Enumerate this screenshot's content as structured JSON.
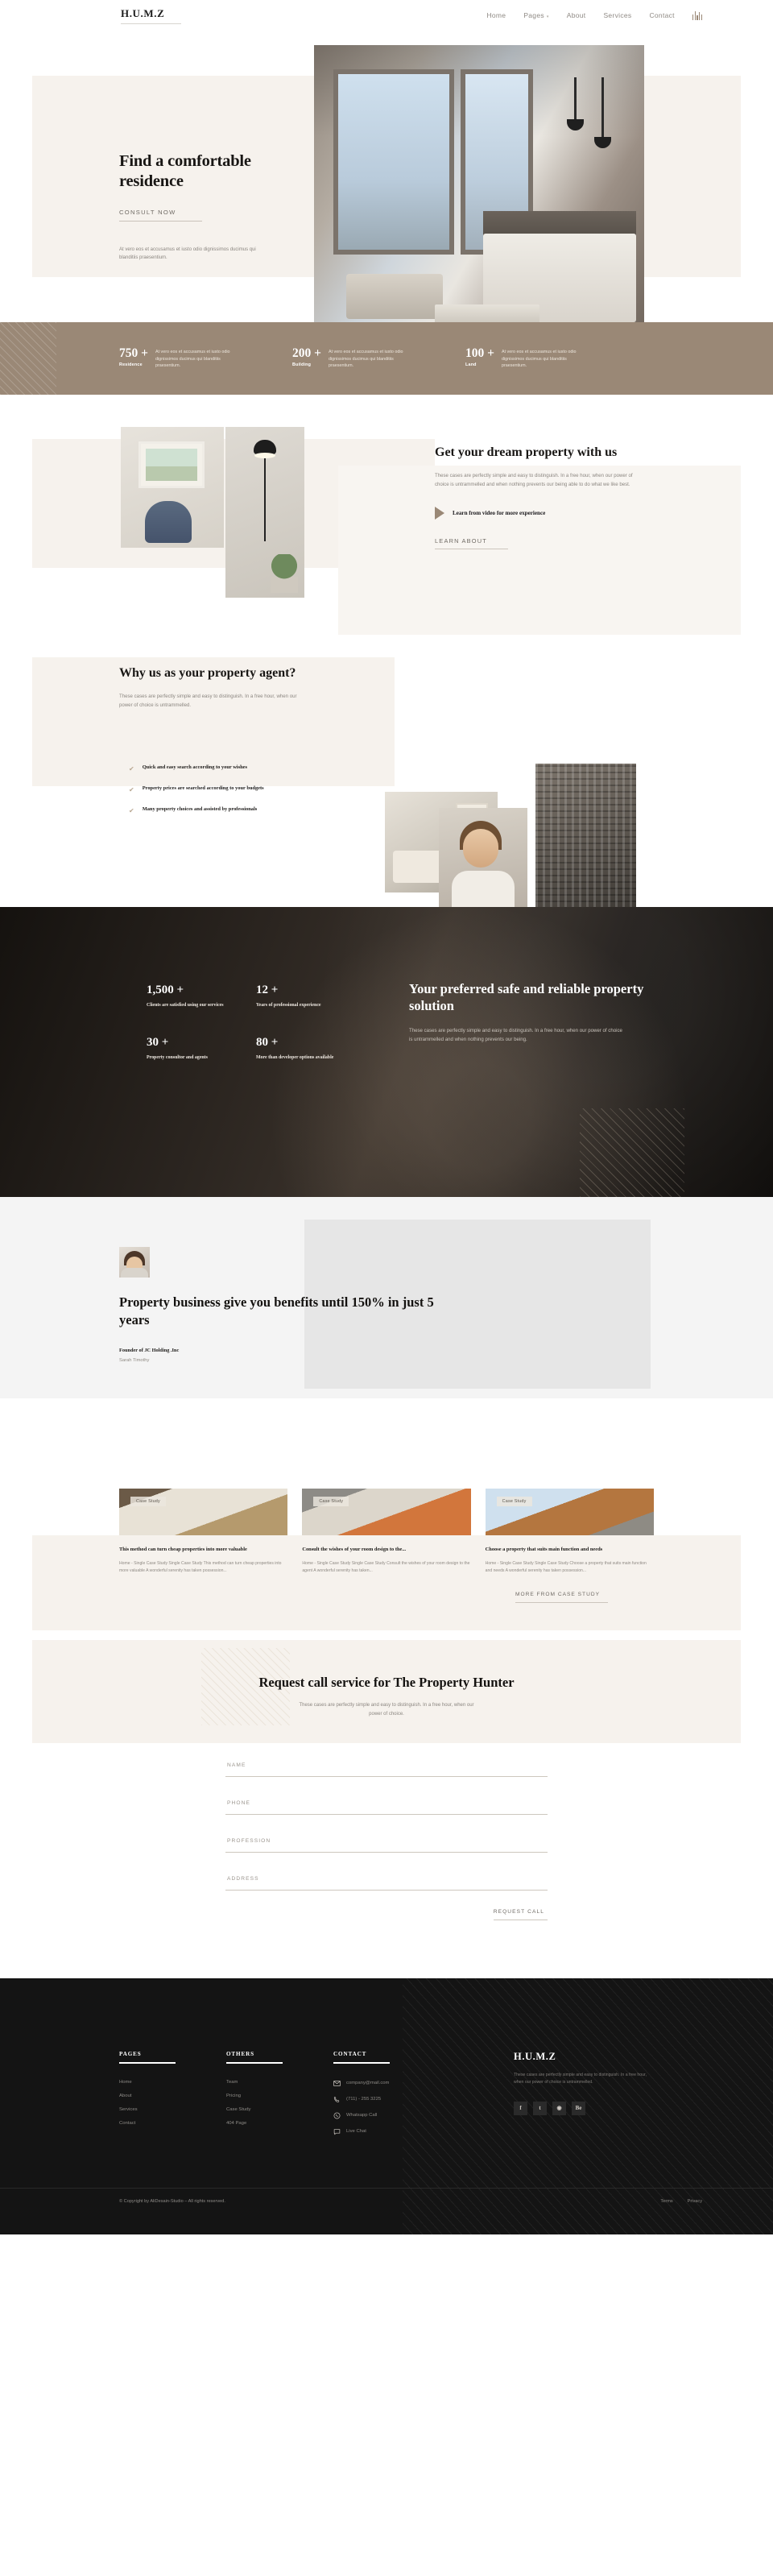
{
  "brand": "H.U.M.Z",
  "nav": {
    "items": [
      {
        "label": "Home",
        "dropdown": false
      },
      {
        "label": "Pages",
        "dropdown": true
      },
      {
        "label": "About",
        "dropdown": false
      },
      {
        "label": "Services",
        "dropdown": false
      },
      {
        "label": "Contact",
        "dropdown": false
      }
    ],
    "menu_icon": "equalizer-menu-icon"
  },
  "hero": {
    "title": "Find a comfortable residence",
    "cta": "CONSULT NOW",
    "paragraph": "At vero eos et accusamus et iusto odio dignissimos ducimus qui blanditiis praesentium."
  },
  "stats_bar": {
    "items": [
      {
        "number": "750 +",
        "label": "Residence",
        "desc": "At vero eos et accusamus et iusto odio dignissimos ducimus qui blanditiis praesentium."
      },
      {
        "number": "200 +",
        "label": "Building",
        "desc": "At vero eos et accusamus et iusto odio dignissimos ducimus qui blanditiis praesentium."
      },
      {
        "number": "100 +",
        "label": "Land",
        "desc": "At vero eos et accusamus et iusto odio dignissimos ducimus qui blanditiis praesentium."
      }
    ]
  },
  "dream": {
    "title": "Get your dream property with us",
    "paragraph": "These cases are perfectly simple and easy to distinguish. In a free hour, when our power of choice is untrammelled and when nothing prevents our being able to do what we like best.",
    "video_label": "Learn from video for more experience",
    "cta": "LEARN ABOUT"
  },
  "why": {
    "title": "Why us as your property agent?",
    "paragraph": "These cases are perfectly simple and easy to distinguish. In a free hour, when our power of choice is untrammelled.",
    "items": [
      "Quick and easy search according to your wishes",
      "Property prices are searched according to your budgets",
      "Many property choices and assisted by professionals"
    ]
  },
  "dark_stats": {
    "items": [
      {
        "number": "1,500 +",
        "label": "Clients are satisfied using our services"
      },
      {
        "number": "12 +",
        "label": "Years of professional experience"
      },
      {
        "number": "30 +",
        "label": "Property consultor and agents"
      },
      {
        "number": "80 +",
        "label": "More than developer options available"
      }
    ],
    "title": "Your preferred safe and reliable property solution",
    "paragraph": "These cases are perfectly simple and easy to distinguish. In a free hour, when our power of choice is untrammelled and when nothing prevents our being."
  },
  "testimonial": {
    "quote": "Property business give you benefits until 150% in just 5 years",
    "role": "Founder of JC Holding .Inc",
    "name": "Sarah Timothy"
  },
  "case_study": {
    "tag": "Case Study",
    "cards": [
      {
        "title": "This method can turn cheap properties into more valuable",
        "body": "Home - Single Case Study Single Case Study This method can turn cheap properties into more valuable A wonderful serenity has taken possession..."
      },
      {
        "title": "Consult the wishes of your room design to the...",
        "body": "Home - Single Case Study Single Case Study Consult the wishes of your room design to the agent A wonderful serenity has taken..."
      },
      {
        "title": "Choose a property that suits main function and needs",
        "body": "Home - Single Case Study Single Case Study Choose a property that suits main function and needs A wonderful serenity has taken possession..."
      }
    ],
    "more_label": "MORE FROM CASE STUDY"
  },
  "request": {
    "title": "Request call service for The Property Hunter",
    "paragraph": "These cases are perfectly simple and easy to distinguish. In a free hour, when our power of choice.",
    "fields": [
      {
        "name": "name",
        "placeholder": "NAME",
        "value": ""
      },
      {
        "name": "phone",
        "placeholder": "PHONE",
        "value": ""
      },
      {
        "name": "profession",
        "placeholder": "PROFESSION",
        "value": ""
      },
      {
        "name": "address",
        "placeholder": "ADDRESS",
        "value": ""
      }
    ],
    "submit": "REQUEST CALL"
  },
  "footer": {
    "columns": [
      {
        "heading": "PAGES",
        "links": [
          "Home",
          "About",
          "Services",
          "Contact"
        ]
      },
      {
        "heading": "OTHERS",
        "links": [
          "Team",
          "Pricing",
          "Case Study",
          "404 Page"
        ]
      }
    ],
    "contact": {
      "heading": "CONTACT",
      "items": [
        {
          "icon": "envelope-icon",
          "text": "company@mail.com"
        },
        {
          "icon": "phone-icon",
          "text": "(711) - 255 3225"
        },
        {
          "icon": "whatsapp-icon",
          "text": "Whatsapp Call"
        },
        {
          "icon": "chat-icon",
          "text": "Live Chat"
        }
      ]
    },
    "brand": "H.U.M.Z",
    "brand_text": "These cases are perfectly simple and easy to distinguish. In a free hour, when our power of choice is untrammelled.",
    "socials": [
      {
        "name": "facebook-icon",
        "glyph": "f"
      },
      {
        "name": "twitter-icon",
        "glyph": "t"
      },
      {
        "name": "instagram-icon",
        "glyph": "◉"
      },
      {
        "name": "behance-icon",
        "glyph": "Be"
      }
    ],
    "copyright": "© Copyright by AliDesain-Studio – All rights reserved.",
    "bottom_links": [
      "Terms",
      "Privacy"
    ]
  },
  "colors": {
    "accent": "#9a8876",
    "cream": "#f6f2ed",
    "dark": "#141414"
  }
}
